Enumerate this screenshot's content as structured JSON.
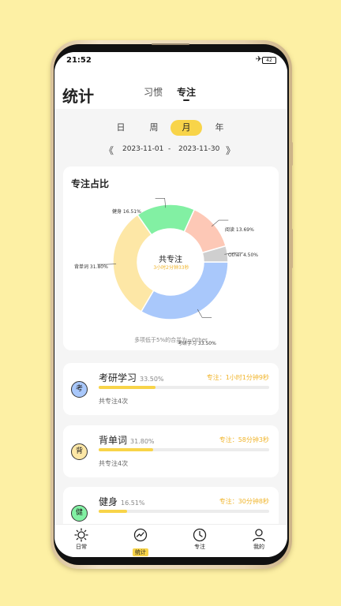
{
  "status": {
    "time": "21:52",
    "airplane": "✈",
    "battery": "42"
  },
  "header": {
    "title": "统计",
    "tabs": [
      "习惯",
      "专注"
    ],
    "active_tab": "专注"
  },
  "periods": [
    "日",
    "周",
    "月",
    "年"
  ],
  "active_period": "月",
  "date_range": {
    "prev": "《",
    "start": "2023-11-01",
    "sep": "-",
    "end": "2023-11-30",
    "next": "》"
  },
  "chart_card": {
    "title": "专注占比",
    "center_title": "共专注",
    "center_sub": "3小时2分钟33秒",
    "note": "多项低于5%的合并为~Other"
  },
  "chart_data": {
    "type": "pie",
    "categories": [
      "考研学习",
      "背单词",
      "健身",
      "阅读",
      "Other"
    ],
    "values": [
      33.5,
      31.8,
      16.51,
      13.69,
      4.5
    ],
    "colors": [
      "#a9c8fb",
      "#fde7a6",
      "#82f0a3",
      "#fdc8b6",
      "#cfcfcf"
    ],
    "labels": [
      "考研学习 33.50%",
      "背单词 31.80%",
      "健身 16.51%",
      "阅读 13.69%",
      "Other 4.50%"
    ]
  },
  "items": [
    {
      "icon": "考",
      "name": "考研学习",
      "pct": "33.50%",
      "focus": "专注：1小时1分钟9秒",
      "count": "共专注4次",
      "fraction": 0.335,
      "color": "#a9c8fb"
    },
    {
      "icon": "背",
      "name": "背单词",
      "pct": "31.80%",
      "focus": "专注：58分钟3秒",
      "count": "共专注4次",
      "fraction": 0.318,
      "color": "#fde7a6"
    },
    {
      "icon": "健",
      "name": "健身",
      "pct": "16.51%",
      "focus": "专注：30分钟8秒",
      "count": "",
      "fraction": 0.1651,
      "color": "#82f0a3"
    }
  ],
  "nav": [
    {
      "label": "日常",
      "icon": "sun-icon"
    },
    {
      "label": "统计",
      "icon": "chart-icon"
    },
    {
      "label": "专注",
      "icon": "clock-icon"
    },
    {
      "label": "我的",
      "icon": "user-icon"
    }
  ],
  "active_nav": "统计"
}
